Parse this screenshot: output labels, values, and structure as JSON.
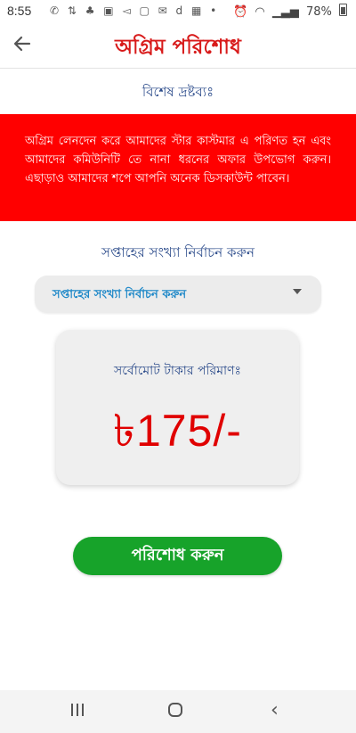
{
  "status_bar": {
    "time": "8:55",
    "battery_percent": "78%",
    "icons": [
      "whatsapp-icon",
      "data-speed-icon",
      "notification-icons",
      "gallery-icon",
      "d-icon",
      "image-icon",
      "dot-icon",
      "alarm-icon",
      "mute-icon",
      "wifi-icon",
      "signal-icon",
      "battery-icon"
    ]
  },
  "app_bar": {
    "title": "অগ্রিম পরিশোধ",
    "back_icon": "arrow-left-icon"
  },
  "notice": {
    "heading": "বিশেষ দ্রষ্টব্যঃ",
    "text": "অগ্রিম লেনদেন করে আমাদের স্টার কাস্টমার এ পরিণত হন এবং আমাদের কমিউনিটি তে নানা ধরনের অফার উপভোগ করুন। এছাড়াও আমাদের শপে আপনি অনেক ডিসকাউন্ট পাবেন।",
    "background": "#ff0000"
  },
  "week_selection": {
    "label": "সপ্তাহের সংখ্যা নির্বাচন করুন",
    "selected": "সপ্তাহের সংখ্যা নির্বাচন করুন"
  },
  "total": {
    "label": "সর্বোমোট টাকার পরিমাণঃ",
    "amount": "৳175/-"
  },
  "pay_button": {
    "label": "পরিশোধ করুন",
    "color": "#17a32a"
  },
  "colors": {
    "accent_red": "#d81b1b",
    "heading_blue": "#2a4a8a",
    "select_blue": "#1e88c8"
  }
}
